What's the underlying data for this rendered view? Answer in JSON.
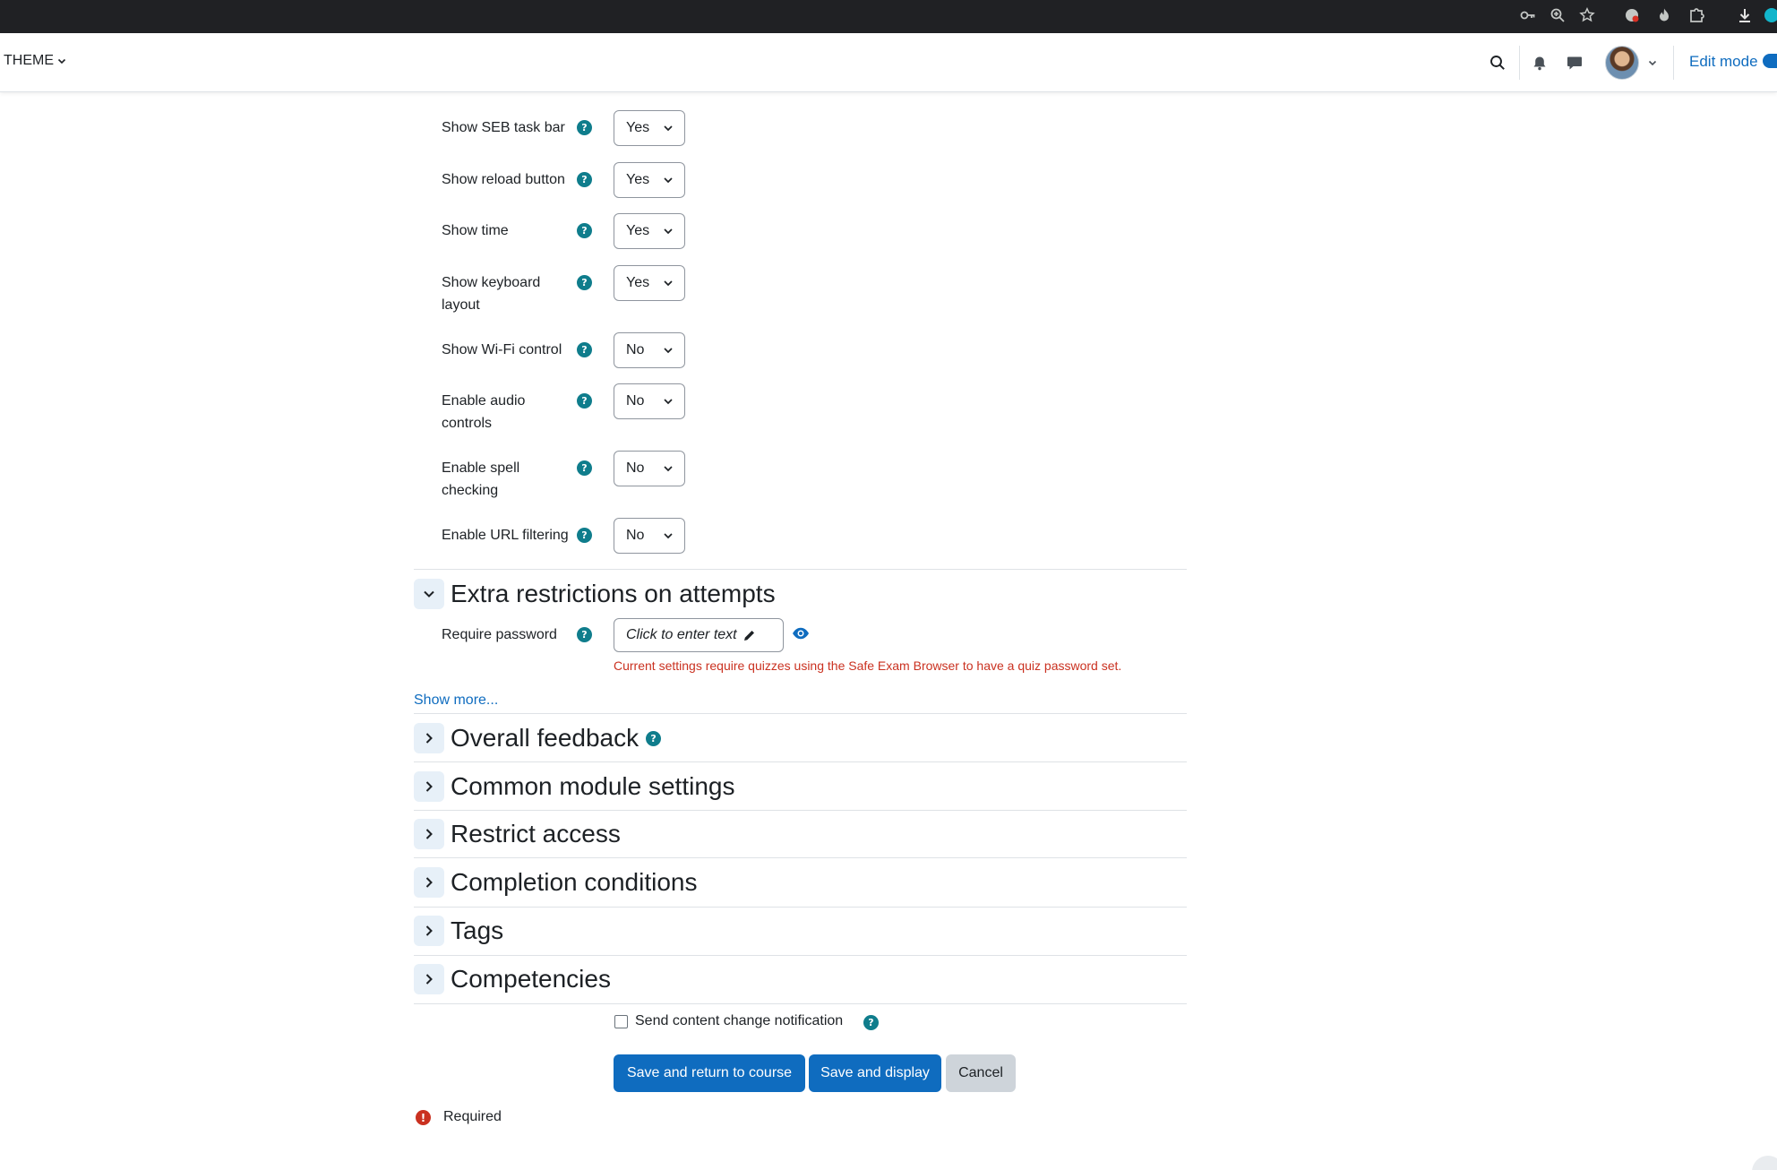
{
  "browser": {
    "icons": [
      "key-icon",
      "zoom-icon",
      "bookmark-star-icon",
      "extension-icon",
      "flame-extension-icon",
      "puzzle-icon",
      "download-icon",
      "profile-icon"
    ]
  },
  "navbar": {
    "theme_menu": "THEME",
    "edit_mode_label": "Edit mode",
    "icons": [
      "search-icon",
      "bell-icon",
      "messages-icon",
      "user-menu-chevron-icon"
    ]
  },
  "seb_settings": [
    {
      "label": "Show SEB task bar",
      "value": "Yes"
    },
    {
      "label": "Show reload button",
      "value": "Yes"
    },
    {
      "label": "Show time",
      "value": "Yes"
    },
    {
      "label": "Show keyboard layout",
      "value": "Yes"
    },
    {
      "label": "Show Wi-Fi control",
      "value": "No"
    },
    {
      "label": "Enable audio controls",
      "value": "No"
    },
    {
      "label": "Enable spell checking",
      "value": "No"
    },
    {
      "label": "Enable URL filtering",
      "value": "No"
    }
  ],
  "extra_restrictions": {
    "title": "Extra restrictions on attempts",
    "password_label": "Require password",
    "password_placeholder": "Click to enter text",
    "error": "Current settings require quizzes using the Safe Exam Browser to have a quiz password set.",
    "show_more": "Show more..."
  },
  "sections": [
    {
      "title": "Overall feedback",
      "has_help": true
    },
    {
      "title": "Common module settings",
      "has_help": false
    },
    {
      "title": "Restrict access",
      "has_help": false
    },
    {
      "title": "Completion conditions",
      "has_help": false
    },
    {
      "title": "Tags",
      "has_help": false
    },
    {
      "title": "Competencies",
      "has_help": false
    }
  ],
  "notification": {
    "label": "Send content change notification",
    "checked": false
  },
  "buttons": {
    "save_return": "Save and return to course",
    "save_display": "Save and display",
    "cancel": "Cancel"
  },
  "required_legend": "Required",
  "help_glyph": "?",
  "required_glyph": "!",
  "colors": {
    "primary": "#0f6cbf",
    "help_icon": "#0f7d8c",
    "error": "#ca3120"
  }
}
